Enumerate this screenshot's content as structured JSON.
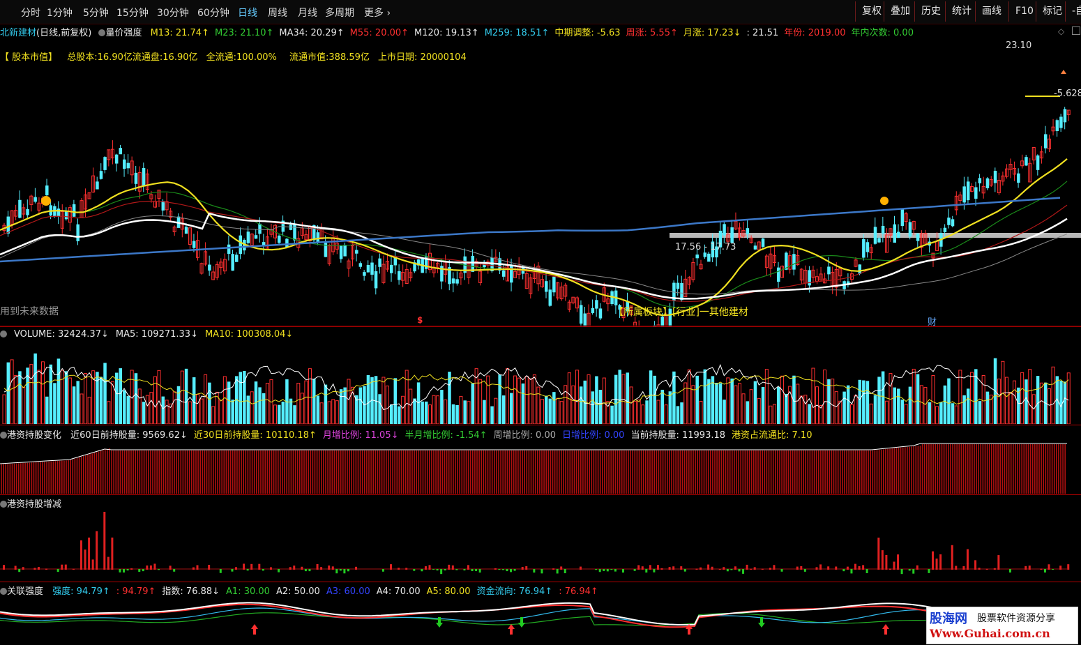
{
  "toolbar": {
    "periods": [
      "分时",
      "1分钟",
      "5分钟",
      "15分钟",
      "30分钟",
      "60分钟",
      "日线",
      "周线",
      "月线",
      "多周期",
      "更多"
    ],
    "active_period": "日线",
    "more_arrow": "›",
    "right_buttons": [
      "复权",
      "叠加",
      "历史",
      "统计",
      "画线",
      "F10",
      "标记",
      "-自"
    ]
  },
  "title_row": {
    "stock": "北新建材",
    "mode": "(日线,前复权)",
    "indicator": "量价强度",
    "items": [
      {
        "label": "M13: 21.74",
        "color": "y",
        "arrow": "↑"
      },
      {
        "label": "M23: 21.10",
        "color": "g",
        "arrow": "↑"
      },
      {
        "label": "MA34: 20.29",
        "color": "w",
        "arrow": "↑"
      },
      {
        "label": "M55: 20.00",
        "color": "r",
        "arrow": "↑"
      },
      {
        "label": "M120: 19.13",
        "color": "w",
        "arrow": "↑"
      },
      {
        "label": "M259: 18.51",
        "color": "c",
        "arrow": "↑"
      },
      {
        "label": "中期调整: -5.63",
        "color": "y",
        "arrow": ""
      },
      {
        "label": "周涨: 5.55",
        "color": "r",
        "arrow": "↑"
      },
      {
        "label": "月涨: 17.23",
        "color": "y",
        "arrow": "↓"
      },
      {
        "label": ": 21.51",
        "color": "w",
        "arrow": ""
      },
      {
        "label": "年份: 2019.00",
        "color": "r",
        "arrow": ""
      },
      {
        "label": "年内次数: 0.00",
        "color": "g",
        "arrow": ""
      }
    ]
  },
  "info_row": {
    "label": "【  股本市值】",
    "total_shares": "总股本:16.90亿",
    "float_shares": "流通盘:16.90亿",
    "full_float": "全流通:100.00%",
    "float_value": "流通市值:388.59亿",
    "listing_date": "上市日期: 20000104"
  },
  "annotations": {
    "high": "23.10",
    "adjust": "-5.628",
    "range": "17.56 - 17.73",
    "future_note": "用到未来数据",
    "sector": "【所属板块】[行业]一其他建材",
    "dividend": "$",
    "finance": "财"
  },
  "volume_row": {
    "items": [
      {
        "label": "VOLUME: 32424.37",
        "color": "w",
        "arrow": "↓"
      },
      {
        "label": "MA5: 109271.33",
        "color": "w",
        "arrow": "↓"
      },
      {
        "label": "MA10: 100308.04",
        "color": "y",
        "arrow": "↓"
      }
    ]
  },
  "hk_row": {
    "title": "港资持股变化",
    "items": [
      {
        "label": "近60日前持股量: 9569.62",
        "color": "w",
        "arrow": "↓"
      },
      {
        "label": "近30日前持股量: 10110.18",
        "color": "y",
        "arrow": "↑"
      },
      {
        "label": "月增比例: 11.05",
        "color": "m",
        "arrow": "↓"
      },
      {
        "label": "半月增比例: -1.54",
        "color": "g",
        "arrow": "↑"
      },
      {
        "label": "周增比例: 0.00",
        "color": "gr",
        "arrow": ""
      },
      {
        "label": "日增比例: 0.00",
        "color": "b",
        "arrow": ""
      },
      {
        "label": "当前持股量: 11993.18",
        "color": "w",
        "arrow": ""
      },
      {
        "label": "港资占流通比: 7.10",
        "color": "y",
        "arrow": ""
      }
    ]
  },
  "hk_change_row": {
    "title": "港资持股增减"
  },
  "strength_row": {
    "title": "关联强度",
    "items": [
      {
        "label": "强度: 94.79",
        "color": "c",
        "arrow": "↑"
      },
      {
        "label": ": 94.79",
        "color": "r",
        "arrow": "↑"
      },
      {
        "label": "指数: 76.88",
        "color": "w",
        "arrow": "↓"
      },
      {
        "label": "A1: 30.00",
        "color": "g",
        "arrow": ""
      },
      {
        "label": "A2: 50.00",
        "color": "w",
        "arrow": ""
      },
      {
        "label": "A3: 60.00",
        "color": "b",
        "arrow": ""
      },
      {
        "label": "A4: 70.00",
        "color": "w",
        "arrow": ""
      },
      {
        "label": "A5: 80.00",
        "color": "y",
        "arrow": ""
      },
      {
        "label": "资金流向: 76.94",
        "color": "c",
        "arrow": "↑"
      },
      {
        "label": ": 76.94",
        "color": "r",
        "arrow": "↑"
      }
    ]
  },
  "watermark": {
    "brand": "股海网",
    "slogan": "股票软件资源分享",
    "url": "Www.Guhai.com.cn"
  },
  "colors": {
    "up": "#ff3030",
    "down": "#55eeff",
    "ma_yellow": "#f0e020",
    "ma_white": "#ffffff",
    "ma_blue": "#3c78c8",
    "ma_red": "#c01818",
    "ma_green": "#1a8a1a"
  }
}
